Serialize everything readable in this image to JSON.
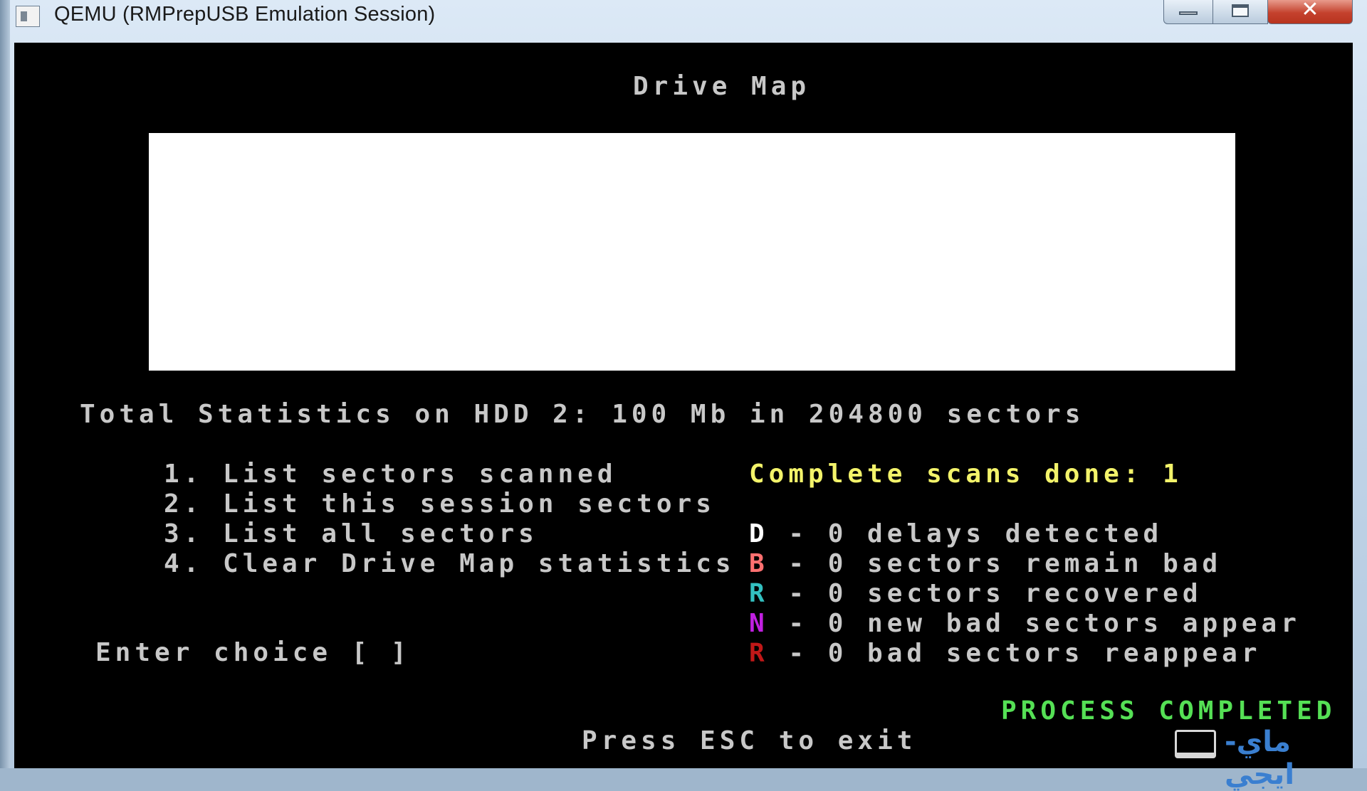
{
  "window": {
    "title": "QEMU (RMPrepUSB Emulation Session)",
    "icon": "qemu-app-icon",
    "buttons": {
      "minimize": "minimize",
      "maximize": "maximize",
      "close": "close"
    }
  },
  "screen": {
    "title": "Drive Map",
    "total_statistics": "Total Statistics on HDD 2: 100 Mb in 204800 sectors",
    "menu": [
      "1. List sectors scanned",
      "2. List this session sectors",
      "3. List all sectors",
      "4. Clear Drive Map statistics"
    ],
    "prompt": "Enter choice [ ]",
    "scans": "Complete scans done: 1",
    "legend": [
      {
        "key": "D",
        "text": " - 0 delays detected",
        "color": "#ffffff"
      },
      {
        "key": "B",
        "text": " - 0 sectors remain bad",
        "color": "#ff7070"
      },
      {
        "key": "R",
        "text": " - 0 sectors recovered",
        "color": "#33c0c0"
      },
      {
        "key": "N",
        "text": " - 0 new bad sectors appear",
        "color": "#c020e0"
      },
      {
        "key": "R",
        "text": " - 0 bad sectors reappear",
        "color": "#c01818"
      }
    ],
    "status": "PROCESS COMPLETED",
    "exit_hint": "Press ESC to exit",
    "text_color": "#c8c8c8",
    "scans_color": "#f3f36a",
    "status_color": "#55e055"
  },
  "watermark": {
    "text": "ماي-ايجي",
    "icon": "laptop-icon"
  }
}
